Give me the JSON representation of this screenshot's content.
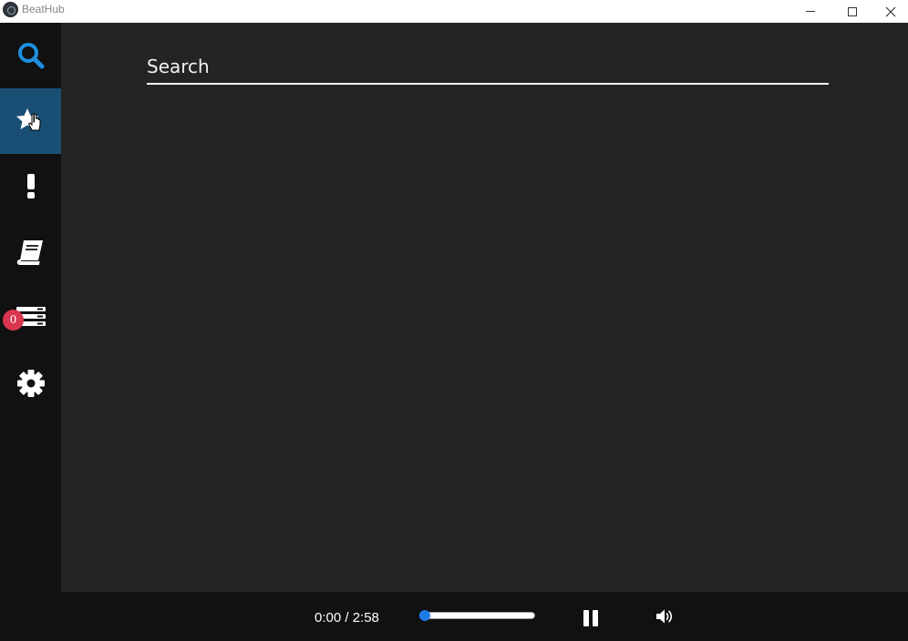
{
  "window": {
    "title": "BeatHub"
  },
  "sidebar": {
    "items": [
      {
        "id": "search",
        "icon": "search-icon",
        "active": false
      },
      {
        "id": "favorites",
        "icon": "star-icon",
        "active": true
      },
      {
        "id": "trending",
        "icon": "exclamation-icon",
        "active": false
      },
      {
        "id": "library",
        "icon": "book-icon",
        "active": false
      },
      {
        "id": "queue",
        "icon": "list-icon",
        "active": false,
        "badge": "0"
      },
      {
        "id": "settings",
        "icon": "gear-icon",
        "active": false
      }
    ]
  },
  "search": {
    "placeholder": "Search",
    "value": ""
  },
  "player": {
    "time_display": "0:00 / 2:58",
    "progress": 0.0,
    "state": "playing",
    "volume_icon": "volume-icon"
  },
  "colors": {
    "accent": "#1e7be6",
    "active_nav": "#1a4f75",
    "badge": "#d9364f"
  }
}
